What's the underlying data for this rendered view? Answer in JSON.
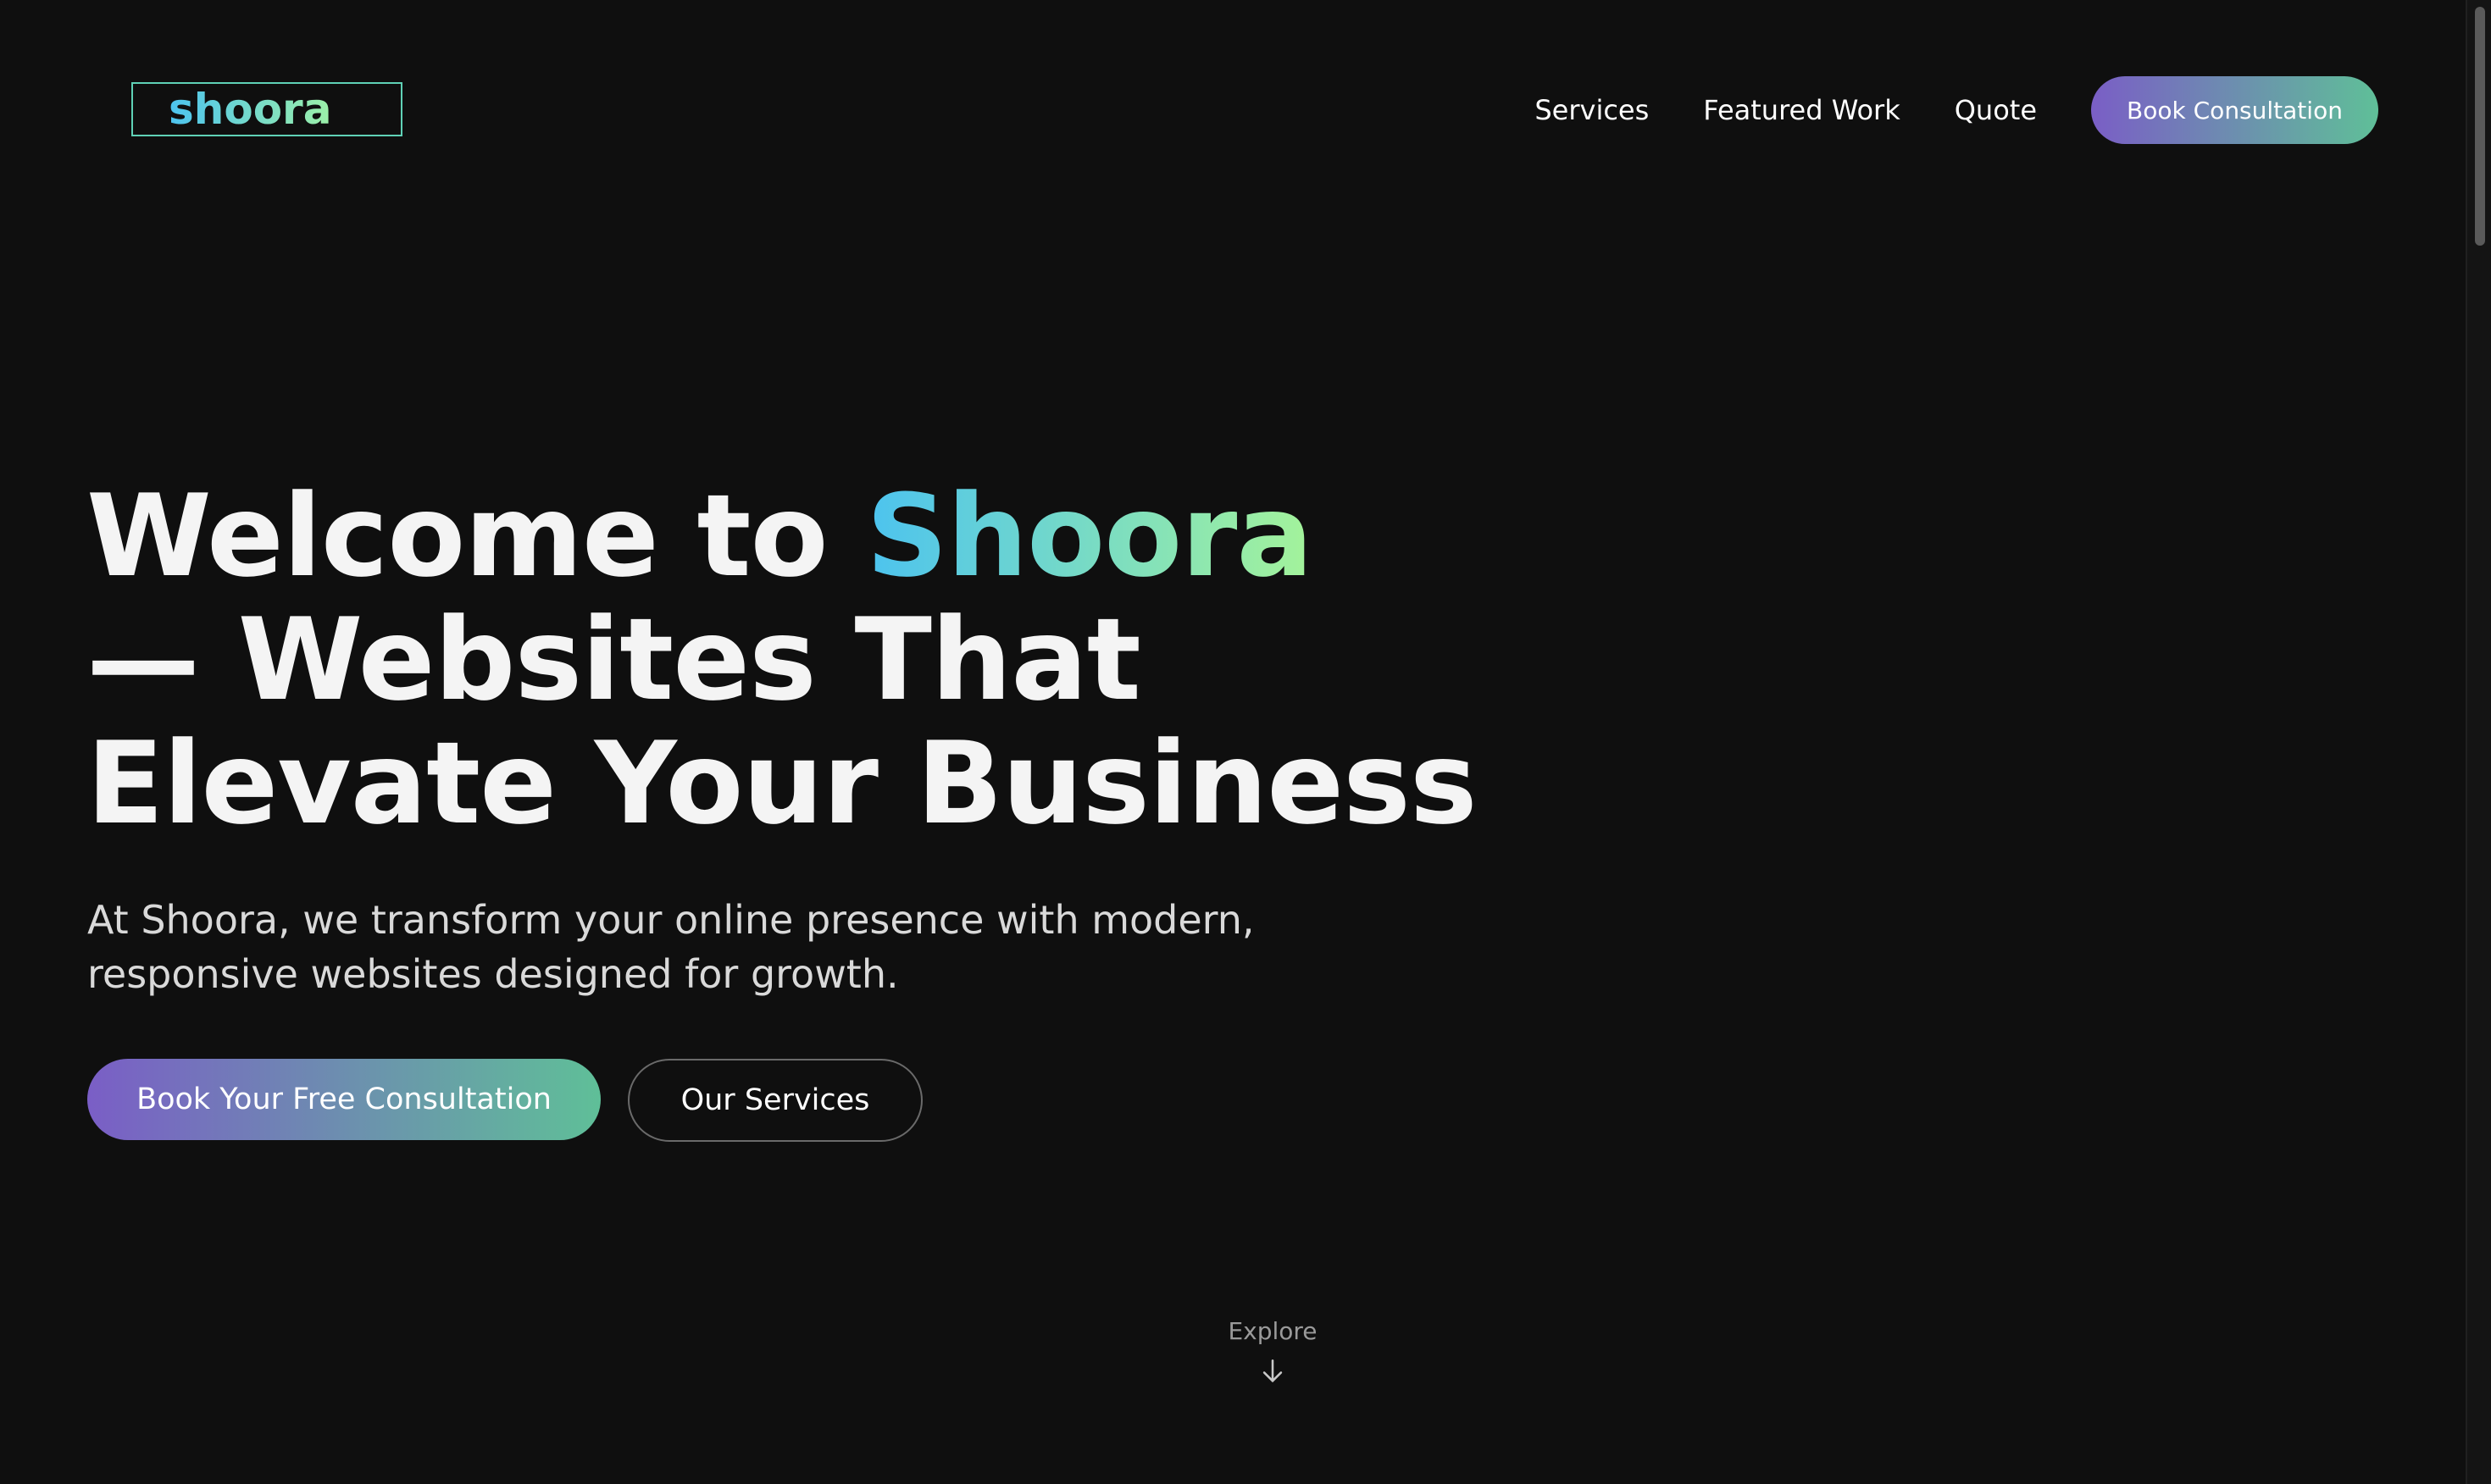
{
  "header": {
    "logo_text": "shoora",
    "nav": [
      {
        "label": "Services"
      },
      {
        "label": "Featured Work"
      },
      {
        "label": "Quote"
      }
    ],
    "cta_label": "Book Consultation"
  },
  "hero": {
    "title_prefix": "Welcome to ",
    "title_highlight": "Shoora",
    "title_line2": "— Websites That",
    "title_line3": "Elevate Your Business",
    "subtitle": "At Shoora, we transform your online presence with modern, responsive websites designed for growth.",
    "primary_button": "Book Your Free Consultation",
    "secondary_button": "Our Services"
  },
  "explore": {
    "label": "Explore",
    "icon": "arrow-down-icon"
  },
  "colors": {
    "background": "#0f0f0f",
    "gradient_start": "#7a5ec6",
    "gradient_end": "#5fbf98",
    "highlight_start": "#4cc3ef",
    "highlight_end": "#a4f39a"
  }
}
